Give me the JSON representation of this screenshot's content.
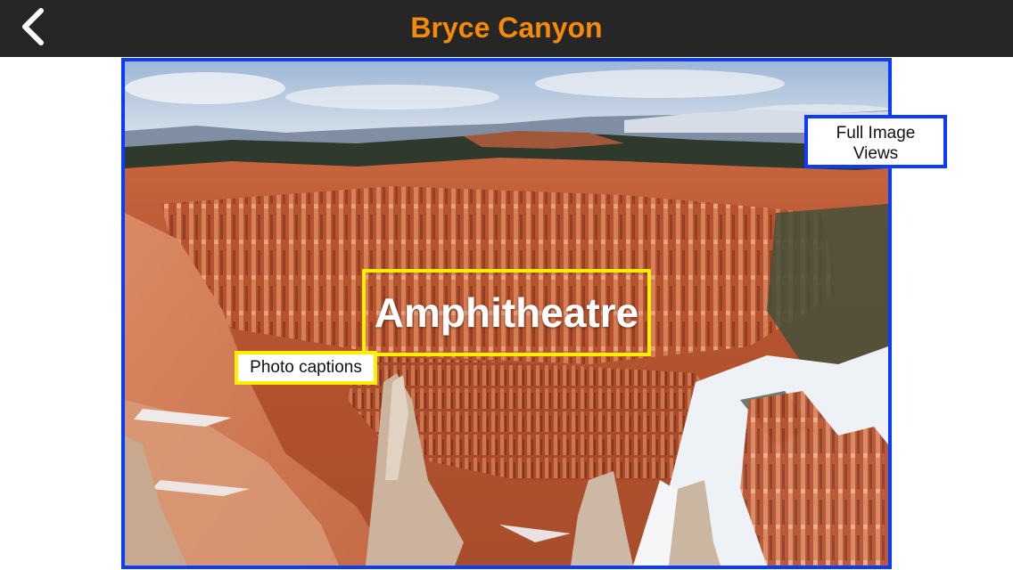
{
  "navbar": {
    "title": "Bryce Canyon",
    "back_icon": "chevron-left-icon",
    "background_color": "#262626",
    "title_color": "#f58a07"
  },
  "photo": {
    "caption": "Amphitheatre",
    "subject": "hoodoo-canyon-photo",
    "frame_color": "#0a3bff",
    "caption_frame_color": "#ffee00"
  },
  "annotations": {
    "full_image": "Full Image Views",
    "captions": "Photo captions"
  }
}
